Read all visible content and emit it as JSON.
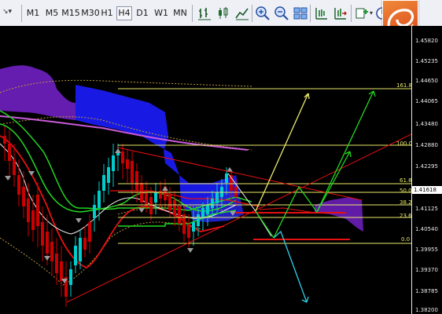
{
  "toolbar": {
    "timeframes": [
      "M1",
      "M5",
      "M15",
      "M30",
      "H1",
      "H4",
      "D1",
      "W1",
      "MN"
    ],
    "active_timeframe": "H4"
  },
  "price_scale": [
    "1.45820",
    "1.45235",
    "1.44650",
    "1.44065",
    "1.43480",
    "1.42880",
    "1.42295",
    "1.41618",
    "1.41125",
    "1.40540",
    "1.39955",
    "1.39370",
    "1.38785",
    "1.38200"
  ],
  "current_price": "1.41618",
  "fibonacci_levels": [
    "161.8",
    "100.0",
    "61.8",
    "50.0",
    "38.2",
    "23.6",
    "0.0"
  ],
  "colors": {
    "background": "#000000",
    "bull_candle": "#00cccc",
    "bear_candle": "#cc0000",
    "ichimoku_cloud_up": "#0000ff",
    "ichimoku_cloud_down": "#7a22c8",
    "fib_lines": "#e8e86a"
  }
}
